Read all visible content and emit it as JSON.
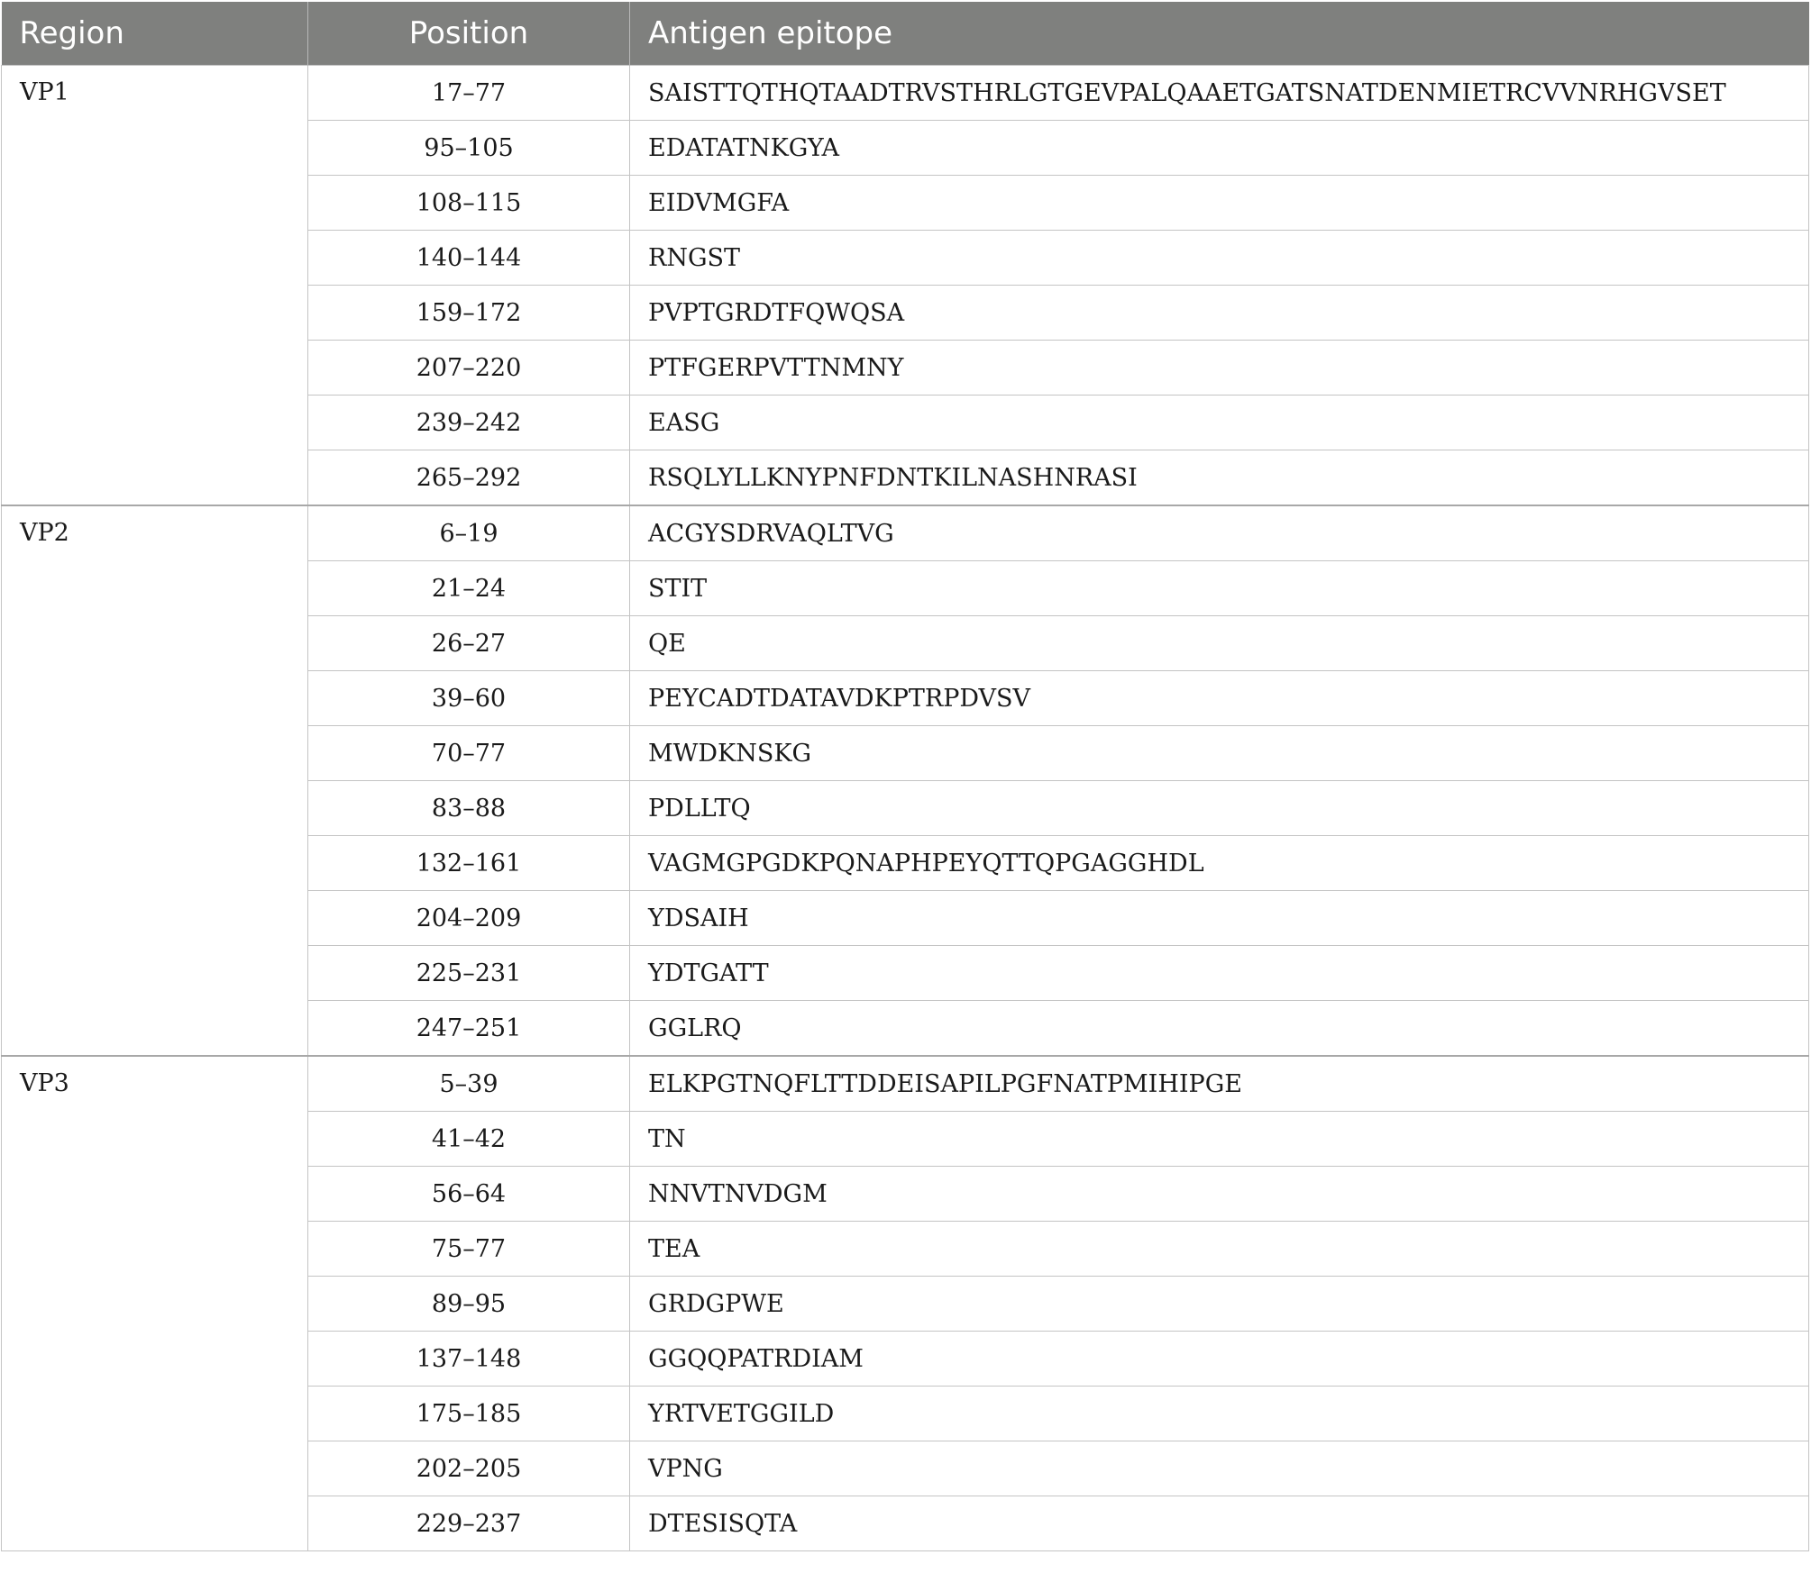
{
  "headers": {
    "region": "Region",
    "position": "Position",
    "epitope": "Antigen epitope"
  },
  "groups": [
    {
      "region": "VP1",
      "rows": [
        {
          "position": "17–77",
          "epitope": "SAISTTQTHQTAADTRVSTHRLGTGEVPALQAAETGATSNATDENMIETRCVVNRHGVSET"
        },
        {
          "position": "95–105",
          "epitope": "EDATATNKGYA"
        },
        {
          "position": "108–115",
          "epitope": "EIDVMGFA"
        },
        {
          "position": "140–144",
          "epitope": "RNGST"
        },
        {
          "position": "159–172",
          "epitope": "PVPTGRDTFQWQSA"
        },
        {
          "position": "207–220",
          "epitope": "PTFGERPVTTNMNY"
        },
        {
          "position": "239–242",
          "epitope": "EASG"
        },
        {
          "position": "265–292",
          "epitope": "RSQLYLLKNYPNFDNTKILNASHNRASI"
        }
      ]
    },
    {
      "region": "VP2",
      "rows": [
        {
          "position": "6–19",
          "epitope": "ACGYSDRVAQLTVG"
        },
        {
          "position": "21–24",
          "epitope": "STIT"
        },
        {
          "position": "26–27",
          "epitope": "QE"
        },
        {
          "position": "39–60",
          "epitope": "PEYCADTDATAVDKPTRPDVSV"
        },
        {
          "position": "70–77",
          "epitope": "MWDKNSKG"
        },
        {
          "position": "83–88",
          "epitope": "PDLLTQ"
        },
        {
          "position": "132–161",
          "epitope": "VAGMGPGDKPQNAPHPEYQTTQPGAGGHDL"
        },
        {
          "position": "204–209",
          "epitope": "YDSAIH"
        },
        {
          "position": "225–231",
          "epitope": "YDTGATT"
        },
        {
          "position": "247–251",
          "epitope": "GGLRQ"
        }
      ]
    },
    {
      "region": "VP3",
      "rows": [
        {
          "position": "5–39",
          "epitope": "ELKPGTNQFLTTDDEISAPILPGFNATPMIHIPGE"
        },
        {
          "position": "41–42",
          "epitope": "TN"
        },
        {
          "position": "56–64",
          "epitope": "NNVTNVDGM"
        },
        {
          "position": "75–77",
          "epitope": "TEA"
        },
        {
          "position": "89–95",
          "epitope": "GRDGPWE"
        },
        {
          "position": "137–148",
          "epitope": "GGQQPATRDIAM"
        },
        {
          "position": "175–185",
          "epitope": "YRTVETGGILD"
        },
        {
          "position": "202–205",
          "epitope": "VPNG"
        },
        {
          "position": "229–237",
          "epitope": "DTESISQTA"
        }
      ]
    }
  ]
}
